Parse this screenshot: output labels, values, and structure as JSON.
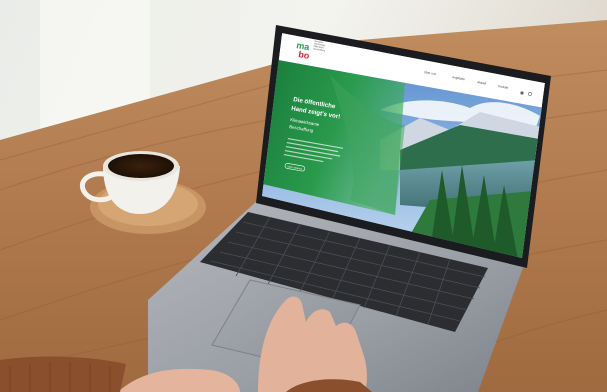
{
  "photo": {
    "subject": "laptop on wooden table with coffee cup"
  },
  "website": {
    "logo": {
      "mark_top": "ma",
      "mark_bottom": "bo",
      "tagline_lines": [
        "Netzwerk",
        "Nachhaltige",
        "Öffentliche",
        "Beschaffung"
      ]
    },
    "nav": [
      "Über uns",
      "Angebote",
      "Aktuell",
      "Kontakt"
    ],
    "hero": {
      "headline_lines": [
        "Die öffentliche",
        "Hand zeigt's vor!"
      ],
      "subheadline_lines": [
        "Klimawirksame",
        "Beschaffung"
      ],
      "button": "Mehr erfahren"
    }
  },
  "colors": {
    "table_wood": "#b07a4e",
    "laptop_body": "#8e9299",
    "hero_green": "#1f8a43",
    "logo_green": "#2c9a4a",
    "logo_red": "#d1263a",
    "coffee": "#2a1608",
    "sweater": "#8a4f2d"
  }
}
